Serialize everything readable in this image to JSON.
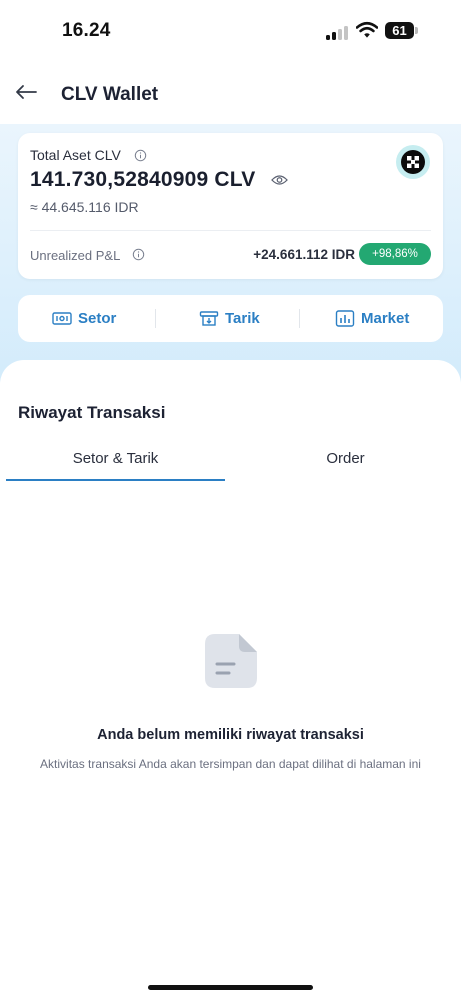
{
  "status_bar": {
    "time": "16.24",
    "battery": "61"
  },
  "header": {
    "title": "CLV Wallet",
    "back_icon": "arrow-left-icon"
  },
  "asset_card": {
    "label": "Total Aset CLV",
    "amount": "141.730,52840909 CLV",
    "idr_equiv": "≈ 44.645.116 IDR",
    "pnl_label": "Unrealized P&L",
    "pnl_value": "+24.661.112 IDR",
    "pnl_percent": "+98,86%",
    "badge_color": "#23a872"
  },
  "actions": {
    "deposit": "Setor",
    "withdraw": "Tarik",
    "market": "Market",
    "accent_color": "#2b7fc4"
  },
  "history": {
    "title": "Riwayat Transaksi",
    "tabs": [
      "Setor & Tarik",
      "Order"
    ],
    "active_tab": "Setor & Tarik",
    "empty_title": "Anda belum memiliki riwayat transaksi",
    "empty_desc": "Aktivitas transaksi Anda akan tersimpan dan dapat dilihat di halaman ini",
    "empty_icon": "document-icon"
  }
}
